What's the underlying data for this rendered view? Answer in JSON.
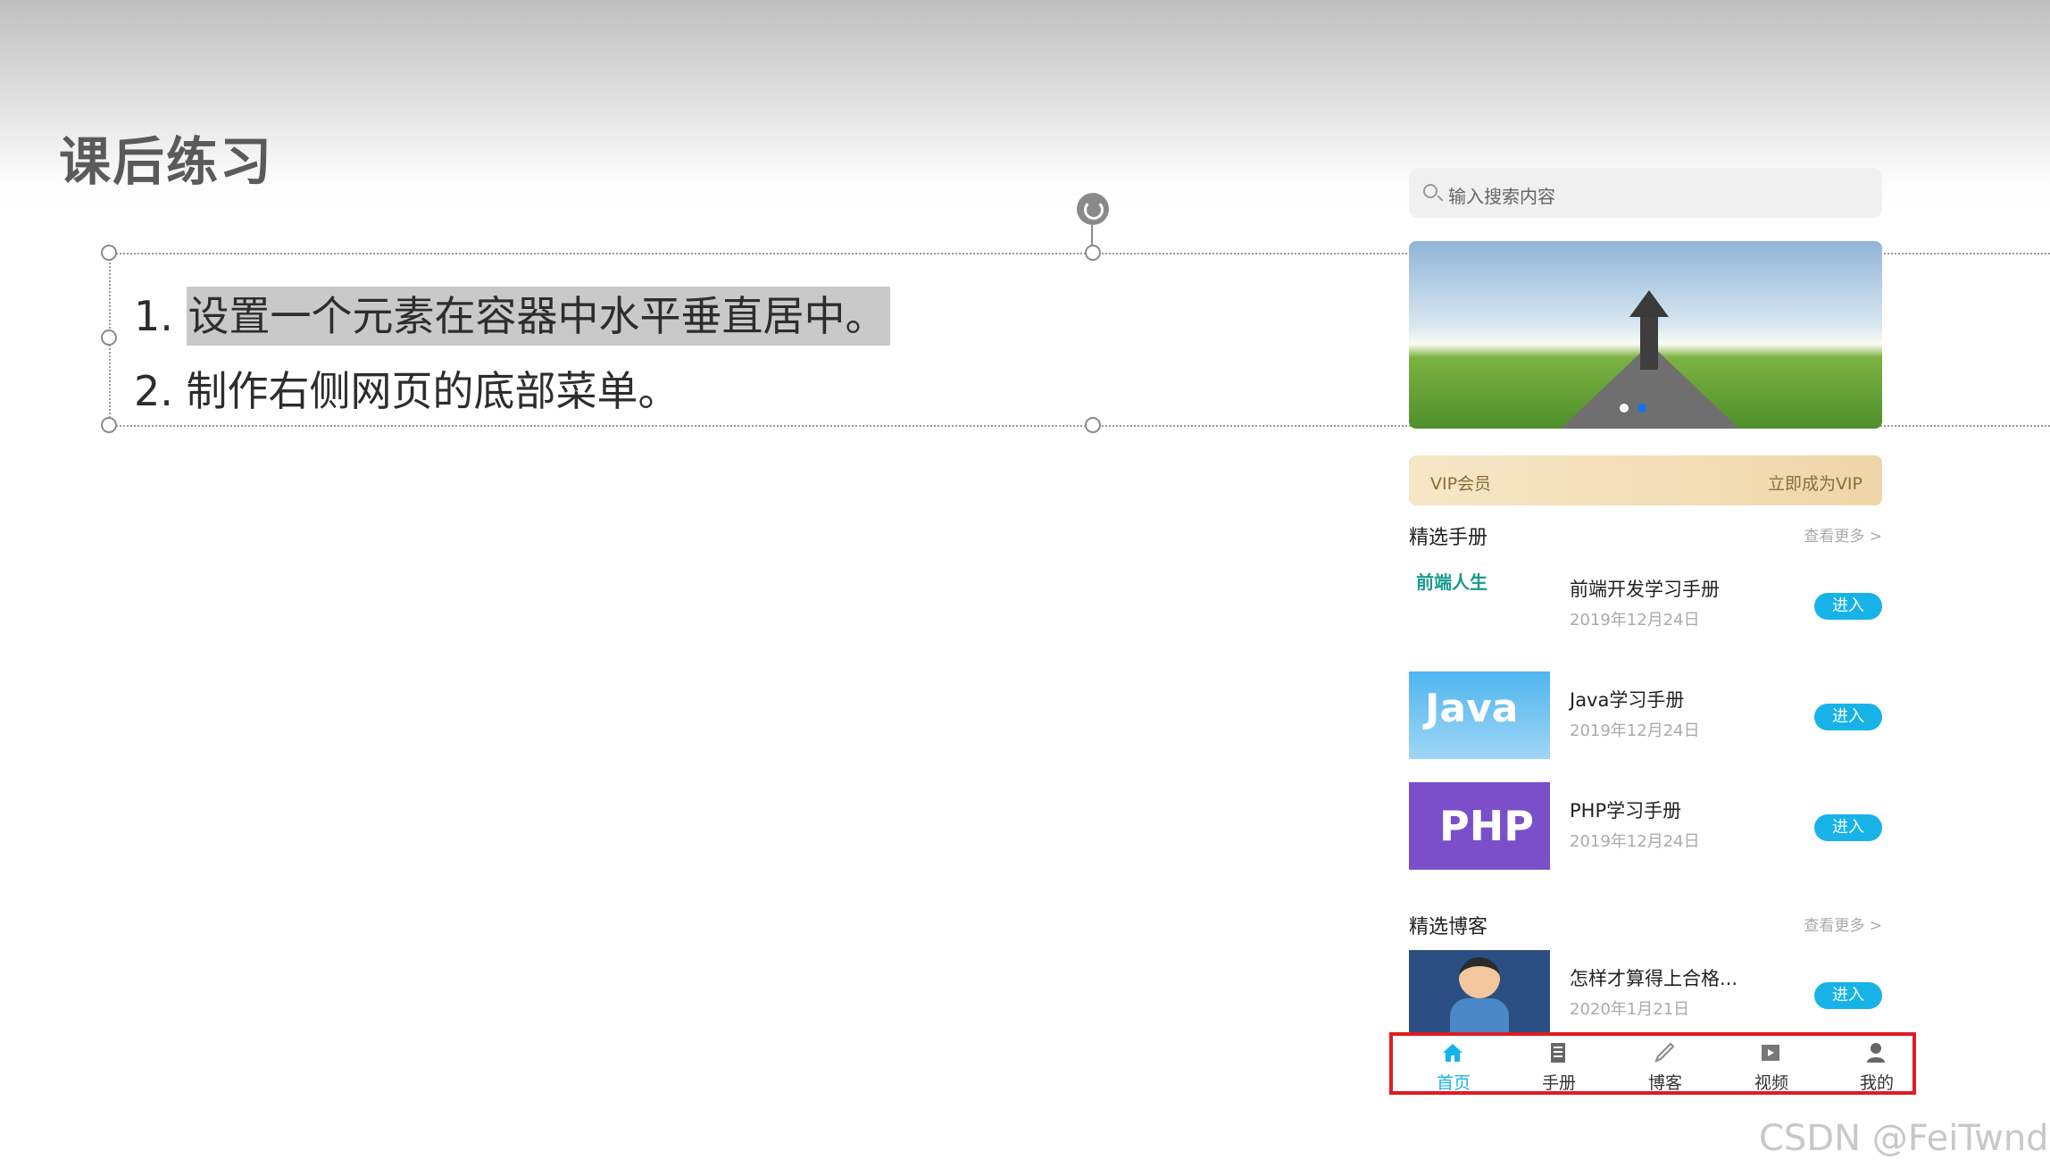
{
  "slide": {
    "title": "课后练习",
    "items": [
      {
        "number": "1.",
        "text": "设置一个元素在容器中水平垂直居中。"
      },
      {
        "number": "2.",
        "text": "制作右侧网页的底部菜单。"
      }
    ]
  },
  "phone": {
    "search_placeholder": "输入搜索内容",
    "vip": {
      "left": "VIP会员",
      "right": "立即成为VIP"
    },
    "manuals": {
      "title": "精选手册",
      "more": "查看更多 >",
      "items": [
        {
          "thumb_text": "前端人生",
          "title": "前端开发学习手册",
          "date": "2019年12月24日",
          "button": "进入"
        },
        {
          "thumb_text": "Java",
          "title": "Java学习手册",
          "date": "2019年12月24日",
          "button": "进入"
        },
        {
          "thumb_text": "PHP",
          "title": "PHP学习手册",
          "date": "2019年12月24日",
          "button": "进入"
        }
      ]
    },
    "blogs": {
      "title": "精选博客",
      "more": "查看更多 >",
      "items": [
        {
          "title": "怎样才算得上合格...",
          "date": "2020年1月21日",
          "button": "进入"
        }
      ]
    },
    "tabs": [
      {
        "label": "首页",
        "icon": "home-icon",
        "active": true
      },
      {
        "label": "手册",
        "icon": "book-icon",
        "active": false
      },
      {
        "label": "博客",
        "icon": "pen-icon",
        "active": false
      },
      {
        "label": "视频",
        "icon": "video-icon",
        "active": false
      },
      {
        "label": "我的",
        "icon": "user-icon",
        "active": false
      }
    ],
    "colors": {
      "accent": "#17b3e8",
      "highlight_border": "#e01b24"
    }
  },
  "watermark": "CSDN @FeiTwnd"
}
